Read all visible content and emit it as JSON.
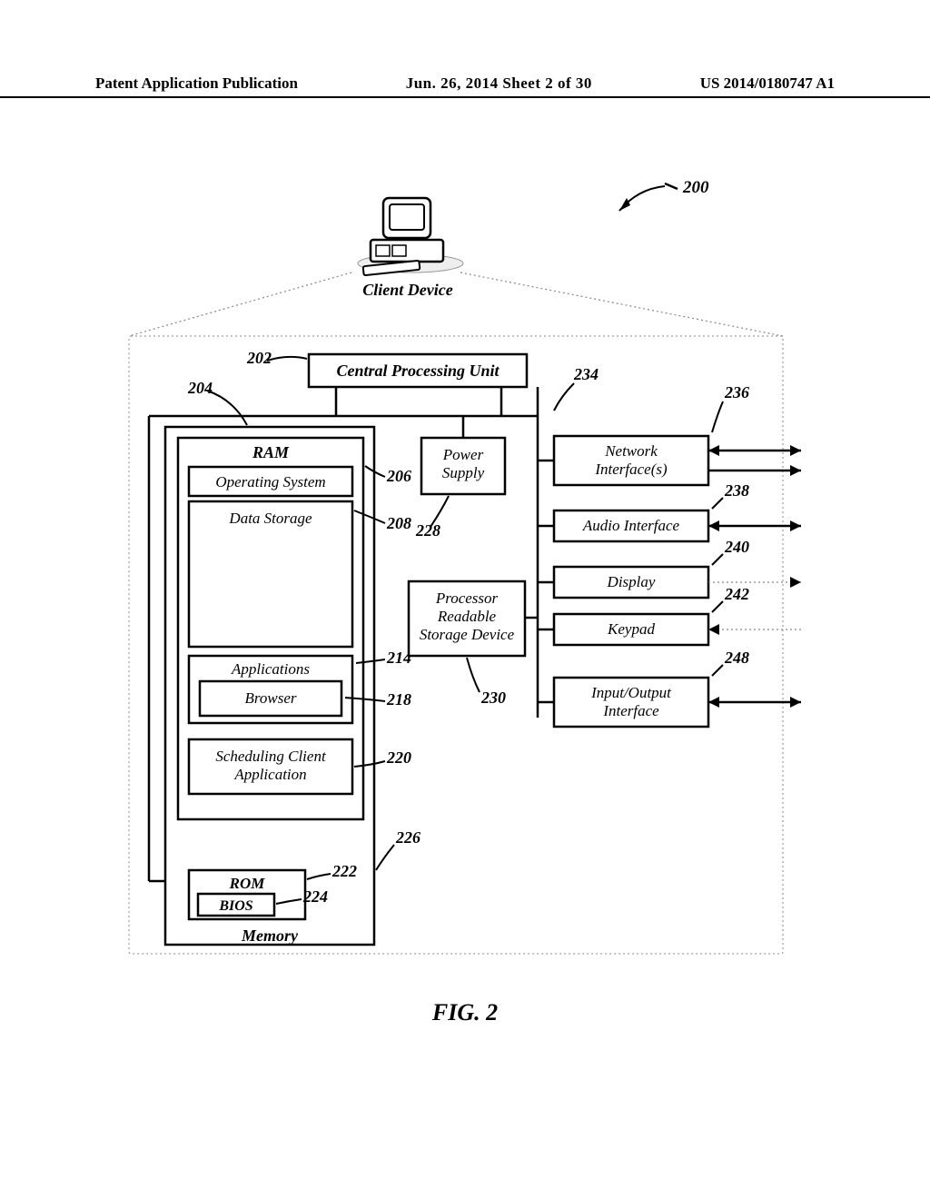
{
  "header": {
    "left": "Patent Application Publication",
    "mid": "Jun. 26, 2014  Sheet 2 of 30",
    "right": "US 2014/0180747 A1"
  },
  "figureCaption": "FIG. 2",
  "refs": {
    "r200": "200",
    "r202": "202",
    "r204": "204",
    "r206": "206",
    "r208": "208",
    "r214": "214",
    "r218": "218",
    "r220": "220",
    "r222": "222",
    "r224": "224",
    "r226": "226",
    "r228": "228",
    "r230": "230",
    "r234": "234",
    "r236": "236",
    "r238": "238",
    "r240": "240",
    "r242": "242",
    "r248": "248"
  },
  "labels": {
    "clientDevice": "Client Device",
    "cpu": "Central Processing Unit",
    "ram": "RAM",
    "os": "Operating System",
    "dataStorage": "Data Storage",
    "apps": "Applications",
    "browser": "Browser",
    "sched1": "Scheduling Client",
    "sched2": "Application",
    "rom": "ROM",
    "bios": "BIOS",
    "memory": "Memory",
    "power1": "Power",
    "power2": "Supply",
    "prsd1": "Processor",
    "prsd2": "Readable",
    "prsd3": "Storage Device",
    "net1": "Network",
    "net2": "Interface(s)",
    "audio": "Audio Interface",
    "display": "Display",
    "keypad": "Keypad",
    "io1": "Input/Output",
    "io2": "Interface"
  }
}
